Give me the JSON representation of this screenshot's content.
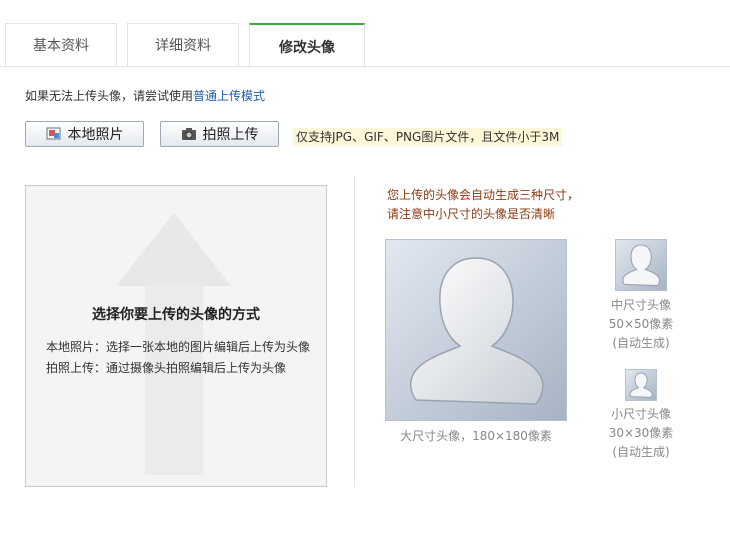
{
  "tabs": [
    {
      "label": "基本资料"
    },
    {
      "label": "详细资料"
    },
    {
      "label": "修改头像"
    }
  ],
  "tip": {
    "text": "如果无法上传头像，请尝试使用",
    "link": "普通上传模式"
  },
  "buttons": {
    "local": "本地照片",
    "photo": "拍照上传"
  },
  "notice": "仅支持JPG、GIF、PNG图片文件，且文件小于3M",
  "panel": {
    "title": "选择你要上传的头像的方式",
    "line1": "本地照片：选择一张本地的图片编辑后上传为头像",
    "line2": "拍照上传：通过摄像头拍照编辑后上传为头像"
  },
  "sizes_notice": {
    "line1": "您上传的头像会自动生成三种尺寸，",
    "line2": "请注意中小尺寸的头像是否清晰"
  },
  "large": {
    "caption": "大尺寸头像，180×180像素"
  },
  "medium": {
    "name": "中尺寸头像",
    "dims": "50×50像素",
    "note": "(自动生成)"
  },
  "small": {
    "name": "小尺寸头像",
    "dims": "30×30像素",
    "note": "(自动生成)"
  },
  "colors": {
    "tab_active_border": "#3cab3c",
    "link": "#1f5fa8",
    "notice_bg": "#fdf6d8",
    "notice_text": "#8b3a12"
  },
  "icons": [
    "picture-icon",
    "camera-icon",
    "upload-arrow-icon",
    "default-avatar-icon"
  ]
}
